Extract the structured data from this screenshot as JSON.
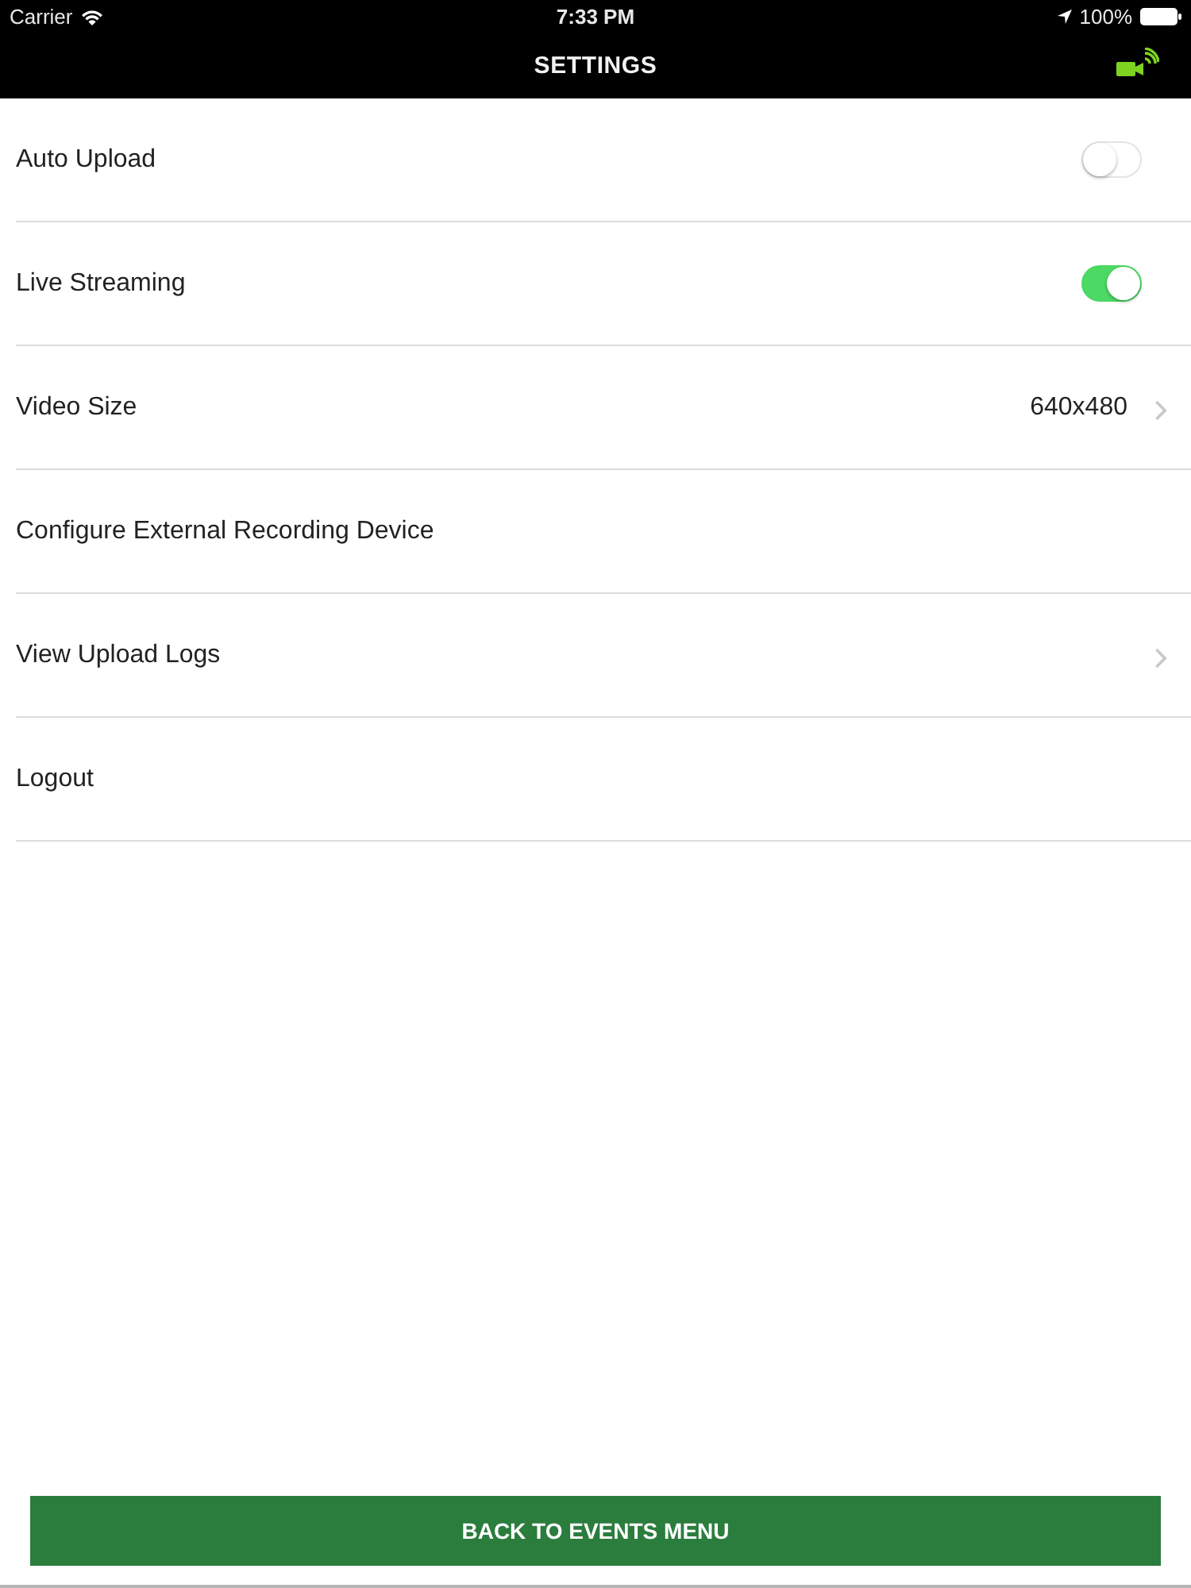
{
  "status_bar": {
    "carrier": "Carrier",
    "time": "7:33 PM",
    "battery": "100%"
  },
  "nav_bar": {
    "title": "SETTINGS"
  },
  "settings": [
    {
      "kind": "toggle",
      "label": "Auto Upload",
      "on": false
    },
    {
      "kind": "toggle",
      "label": "Live Streaming",
      "on": true
    },
    {
      "kind": "value",
      "label": "Video Size",
      "value": "640x480"
    },
    {
      "kind": "plain",
      "label": "Configure External Recording Device"
    },
    {
      "kind": "link",
      "label": "View Upload Logs"
    },
    {
      "kind": "plain",
      "label": "Logout"
    }
  ],
  "footer": {
    "button": "BACK TO EVENTS MENU"
  }
}
